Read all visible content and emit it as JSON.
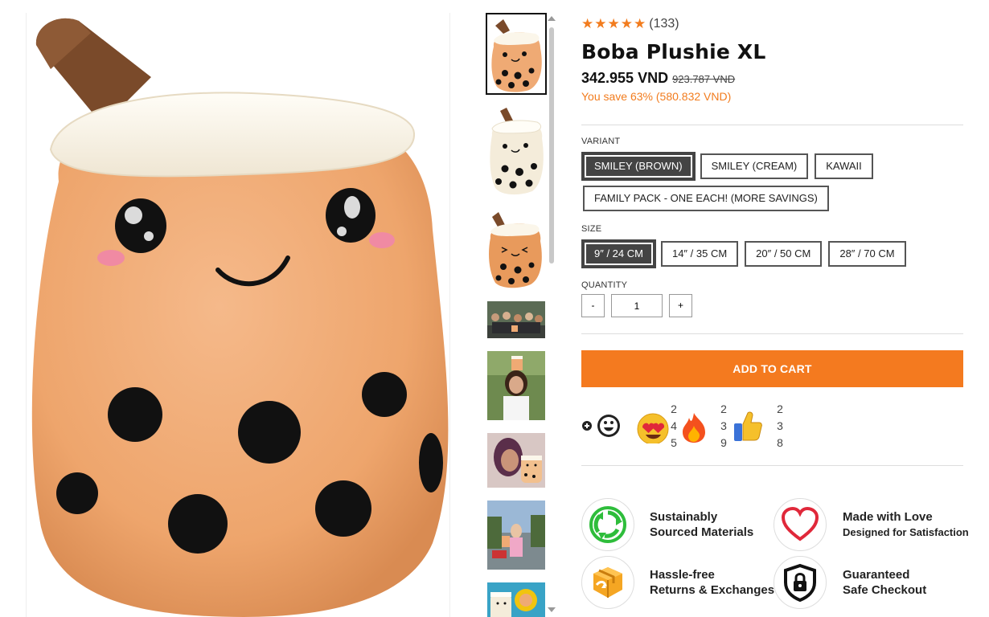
{
  "product": {
    "title": "Boba Plushie XL",
    "rating_stars": 5,
    "review_count": "(133)",
    "price": "342.955 VND",
    "compare_price": "923.787 VND",
    "savings": "You save 63% (580.832 VND)"
  },
  "variant": {
    "label": "VARIANT",
    "options": [
      "SMILEY (BROWN)",
      "SMILEY (CREAM)",
      "KAWAII",
      "FAMILY PACK - ONE EACH! (MORE SAVINGS)"
    ],
    "selected": "SMILEY (BROWN)"
  },
  "size": {
    "label": "SIZE",
    "options": [
      "9″ / 24 CM",
      "14″ / 35 CM",
      "20″ / 50 CM",
      "28″ / 70 CM"
    ],
    "selected": "9″ / 24 CM"
  },
  "quantity": {
    "label": "QUANTITY",
    "minus": "-",
    "plus": "+",
    "value": "1"
  },
  "cart": {
    "label": "ADD TO CART"
  },
  "reactions": [
    {
      "icon": "heart-eyes-emoji-icon",
      "digits": [
        "2",
        "4",
        "5"
      ]
    },
    {
      "icon": "fire-emoji-icon",
      "digits": [
        "2",
        "3",
        "9"
      ]
    },
    {
      "icon": "thumbs-up-emoji-icon",
      "digits": [
        "2",
        "3",
        "8"
      ]
    }
  ],
  "features": [
    {
      "icon": "recycle-icon",
      "title": "Sustainably",
      "sub": "Sourced Materials",
      "sub_small": false
    },
    {
      "icon": "heart-icon",
      "title": "Made with Love",
      "sub": "Designed for Satisfaction",
      "sub_small": true
    },
    {
      "icon": "package-icon",
      "title": "Hassle-free",
      "sub": "Returns & Exchanges",
      "sub_small": false
    },
    {
      "icon": "lock-shield-icon",
      "title": "Guaranteed",
      "sub": "Safe Checkout",
      "sub_small": false
    }
  ],
  "colors": {
    "accent": "#f47a1f",
    "star": "#f27c1e",
    "selected_bg": "#444444",
    "plush_body": "#efaa74",
    "plush_lid": "#fbf6ea",
    "straw": "#7a4a2a",
    "boba": "#1a1a1a"
  },
  "thumbnails": [
    {
      "name": "thumb-brown-plush",
      "kind": "plush-brown"
    },
    {
      "name": "thumb-cream-plush",
      "kind": "plush-cream"
    },
    {
      "name": "thumb-kawaii-plush",
      "kind": "plush-kawaii"
    },
    {
      "name": "thumb-group-photo",
      "kind": "photo"
    },
    {
      "name": "thumb-woman-photo",
      "kind": "photo"
    },
    {
      "name": "thumb-selfie-photo",
      "kind": "photo"
    },
    {
      "name": "thumb-street-photo",
      "kind": "photo"
    },
    {
      "name": "thumb-family-photo",
      "kind": "photo"
    }
  ]
}
